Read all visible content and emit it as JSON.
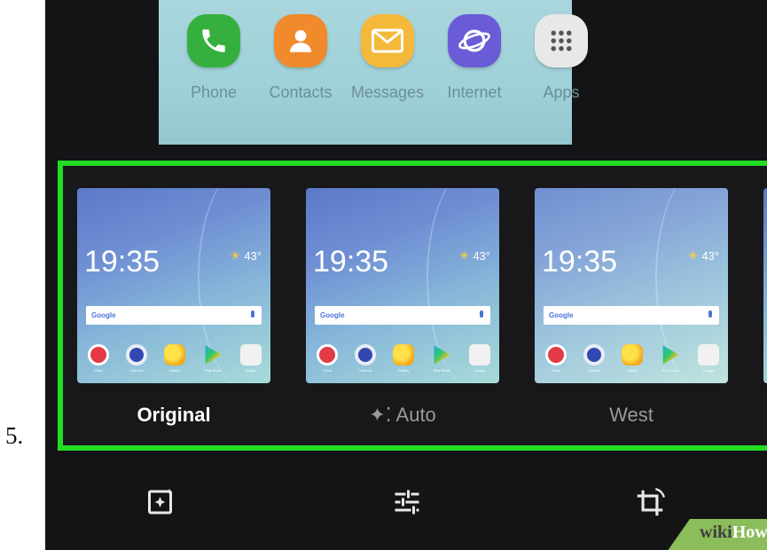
{
  "step": {
    "number": "5."
  },
  "dock": {
    "apps": [
      {
        "label": "Phone",
        "icon": "phone-icon",
        "color": "#35b03e"
      },
      {
        "label": "Contacts",
        "icon": "contact-icon",
        "color": "#f08a2a"
      },
      {
        "label": "Messages",
        "icon": "envelope-icon",
        "color": "#f4b93a"
      },
      {
        "label": "Internet",
        "icon": "planet-icon",
        "color": "#6a5bd6"
      },
      {
        "label": "Apps",
        "icon": "grid-icon",
        "color": "#e8e8e8"
      }
    ]
  },
  "filters": {
    "selected": "Original",
    "items": [
      {
        "label": "Original",
        "clock": "19:35",
        "temp": "43°"
      },
      {
        "label": "Auto",
        "clock": "19:35",
        "temp": "43°"
      },
      {
        "label": "West",
        "clock": "19:35",
        "temp": "43°"
      }
    ],
    "highlight_color": "#22dd22"
  },
  "thumb_apps": [
    "Clock",
    "Camera",
    "Gallery",
    "Play Store",
    "Google"
  ],
  "thumb_google": "Google",
  "toolbar": {
    "tools": [
      "magic-edit-icon",
      "adjust-sliders-icon",
      "crop-rotate-icon"
    ]
  },
  "watermark": {
    "part1": "wiki",
    "part2": "How"
  }
}
